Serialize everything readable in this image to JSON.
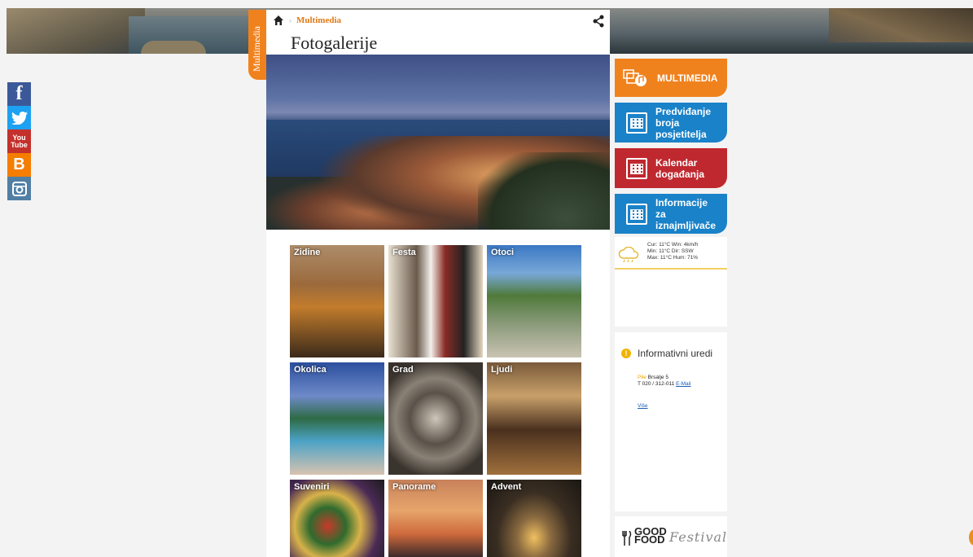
{
  "social": [
    "facebook",
    "twitter",
    "youtube",
    "blogger",
    "instagram"
  ],
  "sidetab": {
    "label": "Multimedia"
  },
  "breadcrumb": {
    "link": "Multimedia"
  },
  "page": {
    "title": "Fotogalerije"
  },
  "gallery": [
    {
      "label": "Zidine"
    },
    {
      "label": "Festa"
    },
    {
      "label": "Otoci"
    },
    {
      "label": "Okolica"
    },
    {
      "label": "Grad"
    },
    {
      "label": "Ljudi"
    },
    {
      "label": "Suveniri"
    },
    {
      "label": "Panorame"
    },
    {
      "label": "Advent"
    }
  ],
  "sidebar": {
    "multimedia": "MULTIMEDIA",
    "forecast": "Predviđanje broja posjetitelja",
    "calendar": "Kalendar događanja",
    "renters": "Informacije za iznajmljivače"
  },
  "weather": {
    "row1": "Cur:  11°C   Win:  4km/h",
    "row2": "Min:  11°C   Dir:   SSW",
    "row3": "Max:  11°C   Hum: 71%"
  },
  "info": {
    "title": "Informativni uredi",
    "office_name": "Pile",
    "office_street": "Brsalje 5",
    "phone": "T 020 / 312-011",
    "email_label": "E-Mail",
    "more": "Više"
  },
  "goodfood": {
    "logo_top": "GOOD",
    "logo_bottom": "FOOD",
    "script": "Festival"
  },
  "colors": {
    "orange": "#f0821e",
    "blue": "#1a82c8",
    "red": "#c0282f"
  }
}
